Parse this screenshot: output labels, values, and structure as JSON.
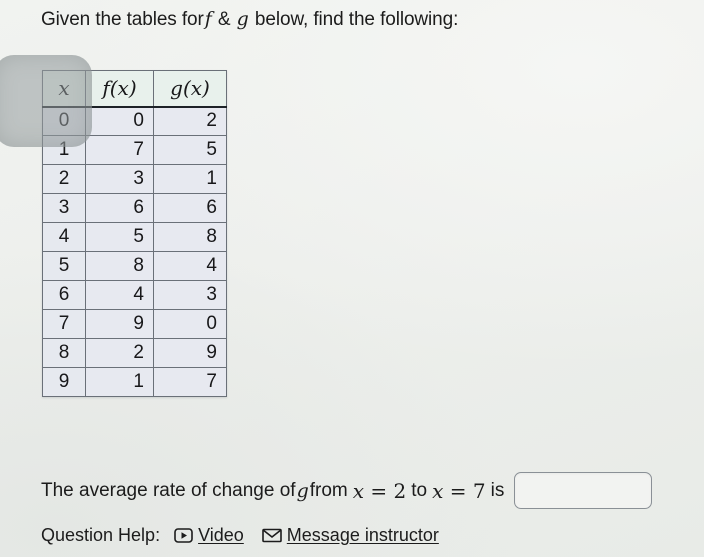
{
  "prompt": {
    "lead": "Given the tables for",
    "var_f": "f",
    "amp": "&",
    "var_g": "g",
    "tail": "below, find the following:"
  },
  "table": {
    "headers": {
      "x": "x",
      "f": "f(x)",
      "g": "g(x)"
    },
    "rows": [
      {
        "x": "0",
        "f": "0",
        "g": "2"
      },
      {
        "x": "1",
        "f": "7",
        "g": "5"
      },
      {
        "x": "2",
        "f": "3",
        "g": "1"
      },
      {
        "x": "3",
        "f": "6",
        "g": "6"
      },
      {
        "x": "4",
        "f": "5",
        "g": "8"
      },
      {
        "x": "5",
        "f": "8",
        "g": "4"
      },
      {
        "x": "6",
        "f": "4",
        "g": "3"
      },
      {
        "x": "7",
        "f": "9",
        "g": "0"
      },
      {
        "x": "8",
        "f": "2",
        "g": "9"
      },
      {
        "x": "9",
        "f": "1",
        "g": "7"
      }
    ]
  },
  "question": {
    "text_before": "The average rate of change of",
    "func": "g",
    "from_word": "from",
    "x1_var": "x",
    "x1_op": "=",
    "x1_val": "2",
    "to_word": "to",
    "x2_var": "x",
    "x2_op": "=",
    "x2_val": "7",
    "is_word": "is",
    "answer_value": "",
    "answer_placeholder": ""
  },
  "help": {
    "label": "Question Help:",
    "video_label": "Video",
    "video_icon": "play-video-icon",
    "message_label": "Message instructor",
    "message_icon": "envelope-icon"
  },
  "colors": {
    "page_background": "#eef0ed",
    "table_header_fill": "#e8f1ec",
    "table_cell_fill": "#e7e9f0",
    "table_border": "#6a7078",
    "text": "#1c1c1c",
    "input_border": "#8a9096"
  }
}
